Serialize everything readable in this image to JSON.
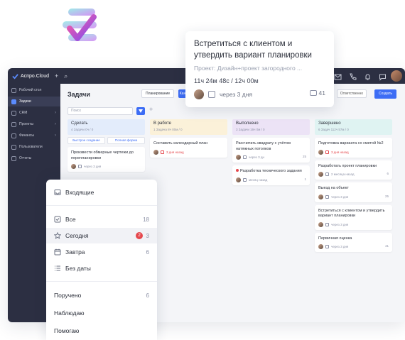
{
  "app": {
    "brand": "Aспро.Cloud"
  },
  "sidebar": {
    "items": [
      {
        "label": "Рабочий стол",
        "active": false,
        "chevron": false
      },
      {
        "label": "Задачи",
        "active": true,
        "chevron": false
      },
      {
        "label": "CRM",
        "active": false,
        "chevron": true
      },
      {
        "label": "Проекты",
        "active": false,
        "chevron": true
      },
      {
        "label": "Финансы",
        "active": false,
        "chevron": true
      },
      {
        "label": "Пользователи",
        "active": false,
        "chevron": false
      },
      {
        "label": "Отчеты",
        "active": false,
        "chevron": false
      }
    ]
  },
  "main": {
    "title": "Задачи",
    "plan_label": "Планирование",
    "kanban_label": "Кан",
    "right_select": "Ответственно",
    "create_label": "Создать",
    "search_placeholder": "Поиск",
    "add_column": "+"
  },
  "columns": [
    {
      "title": "Сделать",
      "stats": "4 Задачи 0ч / 0",
      "color": "#e3ecfb",
      "quick": [
        "Быстрое создание",
        "Полная форма"
      ],
      "cards": [
        {
          "title": "Произвести обмерные чертежи до перепланировки",
          "meta": "через 3 дня",
          "red": false,
          "count": "",
          "dot": false
        }
      ]
    },
    {
      "title": "В работе",
      "stats": "1 Задача 8ч 00м / 0",
      "color": "#fbf1d9",
      "quick": [],
      "cards": [
        {
          "title": "Составить календарный план",
          "meta": "3 дня назад",
          "red": true,
          "count": "",
          "dot": false
        }
      ]
    },
    {
      "title": "Выполнено",
      "stats": "3 Задачи 16ч 0м / 0",
      "color": "#ece3f6",
      "quick": [],
      "cards": [
        {
          "title": "Рассчитать квадрату с учётом натяжных потолков",
          "meta": "через 3 дн",
          "red": false,
          "count": "25",
          "dot": false
        },
        {
          "title": "Разработка технического задания",
          "meta": "месяц назад",
          "red": false,
          "count": "1",
          "dot": true
        }
      ]
    },
    {
      "title": "Завершено",
      "stats": "6 Задач 112ч 57м / 0",
      "color": "#dff3f2",
      "quick": [],
      "cards": [
        {
          "title": "Подготовка варианта со сметой №2",
          "meta": "3 дня назад",
          "red": true,
          "count": "",
          "dot": false
        },
        {
          "title": "Разработать проект планировки",
          "meta": "2 месяца назад",
          "red": false,
          "count": "6",
          "dot": false
        },
        {
          "title": "Выезд на объект",
          "meta": "через 3 дня",
          "red": false,
          "count": "25",
          "dot": false
        },
        {
          "title": "Встретиться с клиентом и утвердить вариант планировки",
          "meta": "через 3 дня",
          "red": false,
          "count": "",
          "dot": false
        },
        {
          "title": "Первичная оценка",
          "meta": "через 3 дня",
          "red": false,
          "count": "41",
          "dot": false
        }
      ]
    }
  ],
  "popup": {
    "title": "Встретиться с клиентом и утвердить вариант планировки",
    "project": "Проект: Дизайн+проект загородного ...",
    "time": "11ч 24м 48с / 12ч 00м",
    "due": "через 3 дня",
    "comments": "41"
  },
  "menu": {
    "inbox": "Входящие",
    "all": {
      "label": "Все",
      "count": "18"
    },
    "today": {
      "label": "Сегодня",
      "badge": "2",
      "count": "3"
    },
    "tomorrow": {
      "label": "Завтра",
      "count": "6"
    },
    "no_date": {
      "label": "Без даты"
    },
    "assigned": {
      "label": "Поручено",
      "count": "6"
    },
    "watching": {
      "label": "Наблюдаю"
    },
    "helping": {
      "label": "Помогаю"
    }
  },
  "colors": {
    "accent": "#3d6df5",
    "sidebar": "#2c2f42",
    "danger": "#e5484d"
  }
}
